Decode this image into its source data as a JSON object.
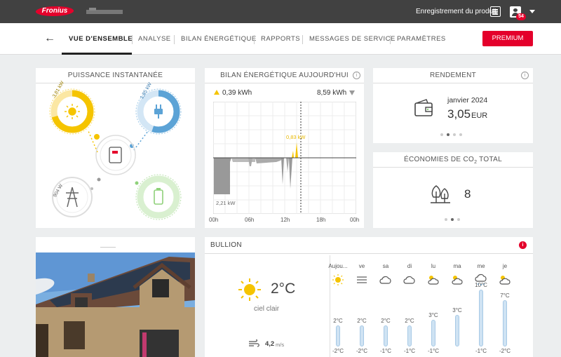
{
  "header": {
    "logo_text": "Fronius",
    "product_registration": "Enregistrement du produit",
    "notifications_count": "54"
  },
  "nav": {
    "tabs": [
      {
        "label": "VUE D'ENSEMBLE"
      },
      {
        "label": "ANALYSE"
      },
      {
        "label": "BILAN ÉNERGÉTIQUE"
      },
      {
        "label": "RAPPORTS"
      },
      {
        "label": "MESSAGES DE SERVICE"
      },
      {
        "label": "PARAMÈTRES"
      }
    ],
    "premium_label": "PREMIUM"
  },
  "power": {
    "title": "PUISSANCE INSTANTANÉE",
    "pv": "3,81 kW",
    "load": "1,85 kW",
    "grid": "904 W",
    "colors": {
      "pv": "#f5c400",
      "load": "#5ca3d6",
      "battery": "#8fd17a",
      "grid": "#999999"
    }
  },
  "energy_today": {
    "title": "BILAN ÉNERGÉTIQUE AUJOURD'HUI",
    "produced": "0,39 kWh",
    "consumed": "8,59 kWh",
    "peak_label": "0,83 kW",
    "min_label": "2,21 kW",
    "x_ticks": [
      "00h",
      "06h",
      "12h",
      "18h",
      "00h"
    ]
  },
  "yield": {
    "title": "RENDEMENT",
    "period": "janvier 2024",
    "value": "3,05",
    "unit": "EUR"
  },
  "co2": {
    "title_prefix": "ÉCONOMIES DE CO",
    "title_sub": "2",
    "title_suffix": " TOTAL",
    "value": "8"
  },
  "weather": {
    "location": "BULLION",
    "current_temp": "2°C",
    "current_desc": "ciel clair",
    "wind_value": "4,2",
    "wind_unit": "m/s",
    "days": [
      {
        "label": "Aujou...",
        "icon": "sun-icon",
        "max": "",
        "min": "-2°C",
        "max_shown": "2°C",
        "level": 0.2
      },
      {
        "label": "ve",
        "icon": "fog-icon",
        "max_shown": "2°C",
        "min": "-2°C",
        "level": 0.2
      },
      {
        "label": "sa",
        "icon": "cloud-icon",
        "max_shown": "2°C",
        "min": "-1°C",
        "level": 0.2
      },
      {
        "label": "di",
        "icon": "cloud-icon",
        "max_shown": "2°C",
        "min": "-1°C",
        "level": 0.2
      },
      {
        "label": "lu",
        "icon": "sun-cloud-icon",
        "max_shown": "3°C",
        "min": "-1°C",
        "level": 0.3
      },
      {
        "label": "ma",
        "icon": "sun-cloud-icon",
        "max_shown": "3°C",
        "min": "",
        "level": 0.4
      },
      {
        "label": "me",
        "icon": "snow-cloud-icon",
        "max_shown": "10°C",
        "min": "-1°C",
        "level": 0.9
      },
      {
        "label": "je",
        "icon": "sun-cloud-icon",
        "max_shown": "7°C",
        "min": "-2°C",
        "level": 0.7
      }
    ]
  }
}
